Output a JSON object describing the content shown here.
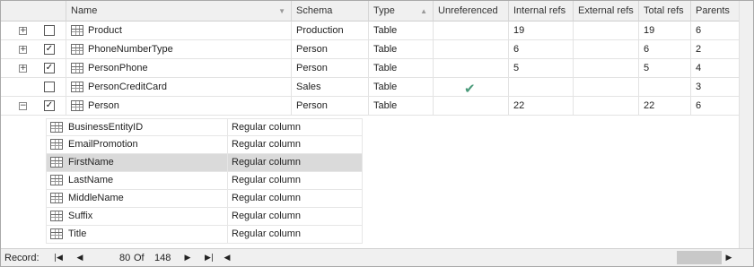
{
  "columns": {
    "name": "Name",
    "schema": "Schema",
    "type": "Type",
    "unreferenced": "Unreferenced",
    "internal_refs": "Internal refs",
    "external_refs": "External refs",
    "total_refs": "Total refs",
    "parents": "Parents"
  },
  "rows": [
    {
      "expander": "+",
      "checked": "",
      "name": "Product",
      "schema": "Production",
      "type": "Table",
      "unreferenced": "",
      "internal_refs": "19",
      "external_refs": "",
      "total_refs": "19",
      "parents": "6"
    },
    {
      "expander": "+",
      "checked": "✓",
      "name": "PhoneNumberType",
      "schema": "Person",
      "type": "Table",
      "unreferenced": "",
      "internal_refs": "6",
      "external_refs": "",
      "total_refs": "6",
      "parents": "2"
    },
    {
      "expander": "+",
      "checked": "✓",
      "name": "PersonPhone",
      "schema": "Person",
      "type": "Table",
      "unreferenced": "",
      "internal_refs": "5",
      "external_refs": "",
      "total_refs": "5",
      "parents": "4"
    },
    {
      "expander": "",
      "checked": "",
      "name": "PersonCreditCard",
      "schema": "Sales",
      "type": "Table",
      "unreferenced": "✔",
      "internal_refs": "",
      "external_refs": "",
      "total_refs": "",
      "parents": "3"
    },
    {
      "expander": "−",
      "checked": "✓",
      "name": "Person",
      "schema": "Person",
      "type": "Table",
      "unreferenced": "",
      "internal_refs": "22",
      "external_refs": "",
      "total_refs": "22",
      "parents": "6"
    }
  ],
  "sub_rows": [
    {
      "name": "BusinessEntityID",
      "kind": "Regular column"
    },
    {
      "name": "EmailPromotion",
      "kind": "Regular column"
    },
    {
      "name": "FirstName",
      "kind": "Regular column"
    },
    {
      "name": "LastName",
      "kind": "Regular column"
    },
    {
      "name": "MiddleName",
      "kind": "Regular column"
    },
    {
      "name": "Suffix",
      "kind": "Regular column"
    },
    {
      "name": "Title",
      "kind": "Regular column"
    }
  ],
  "selected_sub_row": 2,
  "navigator": {
    "record_label": "Record:",
    "current": "80",
    "of_label": "Of",
    "total": "148",
    "first_icon": "first-record-icon",
    "prev_icon": "prev-record-icon",
    "next_icon": "next-record-icon",
    "last_icon": "last-record-icon",
    "scroll_left_icon": "scroll-left-icon",
    "scroll_right_icon": "scroll-right-icon"
  },
  "colors": {
    "header_bg": "#f0f0f0",
    "selection_bg": "#dadada",
    "check_green": "#4a9a7a"
  }
}
